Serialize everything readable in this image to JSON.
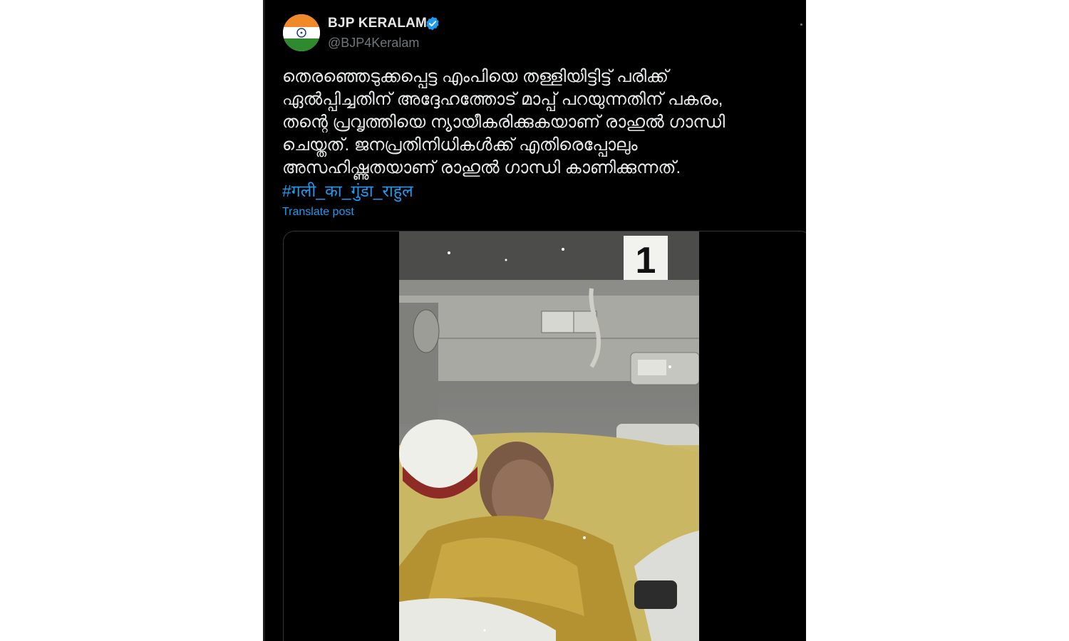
{
  "tweet": {
    "display_name": "BJP KERALAM",
    "handle": "@BJP4Keralam",
    "verified": true,
    "text": "തെരഞ്ഞെടുക്കപ്പെട്ട എംപിയെ  തള്ളിയിട്ടിട്ട് പരിക്ക്\nഏൽപ്പിച്ചതിന് അദ്ദേഹത്തോട് മാപ്പ് പറയുന്നതിന് പകരം,\nതന്റെ പ്രവൃത്തിയെ ന്യായീകരിക്കുകയാണ് രാഹുൽ ഗാന്ധി\nചെയ്തത്. ജനപ്രതിനിധികൾക്ക് എതിരെപ്പോലും\nഅസഹിഷ്ണുതയാണ് രാഹുൽ ഗാന്ധി കാണിക്കുന്നത്.",
    "hashtag": "#गली_का_गुंडा_राहुल",
    "translate_label": "Translate post",
    "media": {
      "bed_number_sign": "1"
    }
  },
  "colors": {
    "background": "#000000",
    "text": "#e7e9ea",
    "link": "#1d9bf0",
    "muted": "#71767b",
    "verified_badge": "#1d9bf0"
  },
  "icons": {
    "verified": "verified-badge-icon",
    "avatar": "india-flag-avatar"
  }
}
